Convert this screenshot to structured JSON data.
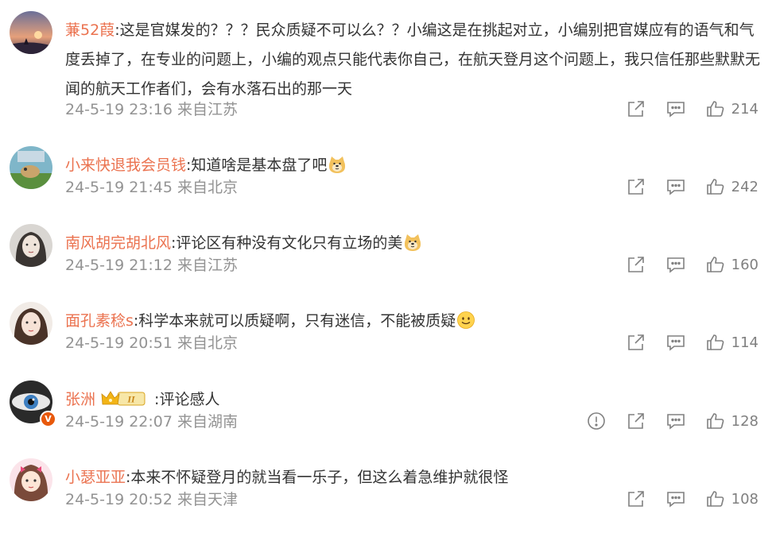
{
  "comments": [
    {
      "username": "蒹52葭",
      "text": ":这是官媒发的？？？民众质疑不可以么？？小编这是在挑起对立，小编别把官媒应有的语气和气度丢掉了，在专业的问题上，小编的观点只能代表你自己，在航天登月这个问题上，我只信任那些默默无闻的航天工作者们，会有水落石出的那一天",
      "meta": "24-5-19 23:16 来自江苏",
      "likes": "214"
    },
    {
      "username": "小来快退我会员钱",
      "text": ":知道啥是基本盘了吧",
      "emoji": "doge-emoji",
      "meta": "24-5-19 21:45 来自北京",
      "likes": "242"
    },
    {
      "username": "南风胡完胡北风",
      "text": ":评论区有种没有文化只有立场的美",
      "emoji": "doge-emoji",
      "meta": "24-5-19 21:12 来自江苏",
      "likes": "160"
    },
    {
      "username": "面孔素稔s",
      "text": ":科学本来就可以质疑啊，只有迷信，不能被质疑",
      "emoji": "smile-emoji",
      "meta": "24-5-19 20:51 来自北京",
      "likes": "114"
    },
    {
      "username": "张洲",
      "badge": "II",
      "text": " :评论感人",
      "meta": "24-5-19 22:07 来自湖南",
      "likes": "128"
    },
    {
      "username": "小瑟亚亚",
      "text": ":本来不怀疑登月的就当看一乐子，但这么着急维护就很怪",
      "meta": "24-5-19 20:52 来自天津",
      "likes": "108"
    }
  ],
  "colors": {
    "username": "#eb7350",
    "text": "#333333",
    "meta": "#939393",
    "icon": "#808080"
  },
  "icons": [
    "repost-icon",
    "comment-icon",
    "like-icon",
    "report-icon"
  ]
}
